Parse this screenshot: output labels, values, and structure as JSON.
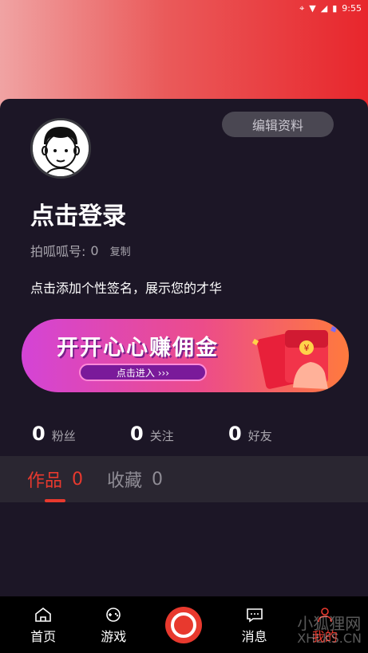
{
  "status": {
    "time": "9:55"
  },
  "profile": {
    "edit_label": "编辑资料",
    "login_label": "点击登录",
    "id_label": "拍呱呱号:",
    "id_value": "0",
    "copy_label": "复制",
    "signature": "点击添加个性签名，展示您的才华"
  },
  "banner": {
    "title": "开开心心赚佣金",
    "button_label": "点击进入 ›››"
  },
  "stats": [
    {
      "value": "0",
      "label": "粉丝"
    },
    {
      "value": "0",
      "label": "关注"
    },
    {
      "value": "0",
      "label": "好友"
    }
  ],
  "tabs": [
    {
      "label": "作品",
      "count": "0"
    },
    {
      "label": "收藏",
      "count": "0"
    }
  ],
  "nav": {
    "home": "首页",
    "games": "游戏",
    "messages": "消息",
    "mine": "我的"
  },
  "watermark": {
    "line1": "小狐狸网",
    "line2": "XHLKS.CN"
  },
  "colors": {
    "accent": "#e8392e",
    "card_bg": "#1c1626",
    "tab_bg": "#2a2631"
  }
}
